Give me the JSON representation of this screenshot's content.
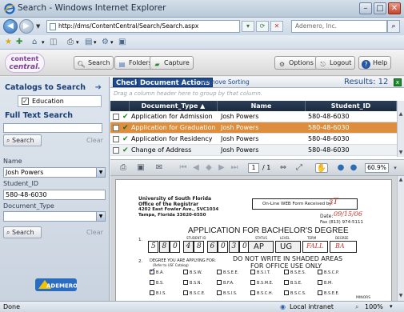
{
  "window": {
    "title": "Search - Windows Internet Explorer"
  },
  "address": {
    "url": "http://dms/ContentCentral/Search/Search.aspx",
    "search_placeholder": "Ademero, Inc."
  },
  "banner": {
    "logo_line1": "content",
    "logo_line2": "central.",
    "buttons": {
      "search": "Search",
      "folders": "Folders",
      "capture": "Capture",
      "options": "Options",
      "logout": "Logout",
      "help": "Help"
    }
  },
  "sidebar": {
    "catalogs_heading": "Catalogs to Search",
    "catalog_item": "Education",
    "fulltext_heading": "Full Text Search",
    "fulltext_value": "",
    "search_button": "Search",
    "clear_label": "Clear",
    "name_label": "Name",
    "name_value": "Josh Powers",
    "student_id_label": "Student_ID",
    "student_id_value": "580-48-6030",
    "doctype_label": "Document_Type",
    "doctype_value": "",
    "search_button2": "Search",
    "clear_label2": "Clear",
    "brand": "ADEMERO"
  },
  "results": {
    "tab_check": "Check",
    "tab_actions": "Document Actions",
    "remove_sorting": "Remove Sorting",
    "count_label": "Results: 12",
    "group_hint": "Drag a column header here to group by that column.",
    "columns": {
      "doctype": "Document_Type ▲",
      "name": "Name",
      "student_id": "Student_ID"
    },
    "rows": [
      {
        "doctype": "Application for Admission",
        "name": "Josh Powers",
        "student_id": "580-48-6030"
      },
      {
        "doctype": "Application for Graduation",
        "name": "Josh Powers",
        "student_id": "580-48-6030"
      },
      {
        "doctype": "Application for Residency",
        "name": "Josh Powers",
        "student_id": "580-48-6030"
      },
      {
        "doctype": "Change of Address",
        "name": "Josh Powers",
        "student_id": "580-48-6030"
      }
    ]
  },
  "viewer": {
    "page": "1",
    "page_total": "/ 1",
    "zoom": "60.9%"
  },
  "document": {
    "uni": "University of South Florida",
    "office": "Office of the Registrar",
    "addr": "4202 East Fowler Ave., SVC1034",
    "city": "Tampa, Florida 33620-6550",
    "online_label": "On-Line WEB Form Received by:",
    "date_label": "Date:",
    "date_value": "09/15/06",
    "fax": "Fax (813) 974-5111",
    "heading": "APPLICATION FOR BACHELOR'S DEGREE",
    "student_id_caption": "STUDENT ID",
    "student_id_digits": [
      "5",
      "8",
      "0",
      "4",
      "8",
      "6",
      "0",
      "3",
      "0"
    ],
    "status_caption": "STATUS",
    "level_caption": "LEVEL",
    "term_caption": "TERM",
    "degree_caption": "DEGREE",
    "status_value": "AP",
    "level_value": "UG",
    "term_value": "FALL",
    "degree_value": "BA",
    "shaded_notice_1": "DO NOT WRITE IN SHADED AREAS",
    "shaded_notice_2": "FOR OFFICE USE ONLY",
    "item2": "DEGREE YOU ARE APPLYING FOR:",
    "item2_note": "(Refer to USF Catalog)",
    "degrees_row1": [
      "B.A.",
      "B.S.W.",
      "B.S.E.E.",
      "B.S.I.T.",
      "B.S.E.S.",
      "B.S.C.P."
    ],
    "degrees_row2": [
      "B.S.",
      "B.S.N.",
      "B.F.A.",
      "B.S.M.E.",
      "B.S.E.",
      "B.M."
    ],
    "degrees_row3": [
      "B.I.S.",
      "B.S.C.E.",
      "B.S.I.S.",
      "B.S.C.H.",
      "B.S.C.S.",
      "B.S.E.E."
    ],
    "minor_label": "MINORS",
    "item1": "1.",
    "item2_num": "2."
  },
  "status": {
    "left": "Done",
    "zone": "Local intranet",
    "zoom": "100%"
  },
  "colors": {
    "accent": "#1e4b8f",
    "selected_row": "#dc8e3c",
    "header_dark": "#1a2a40"
  }
}
